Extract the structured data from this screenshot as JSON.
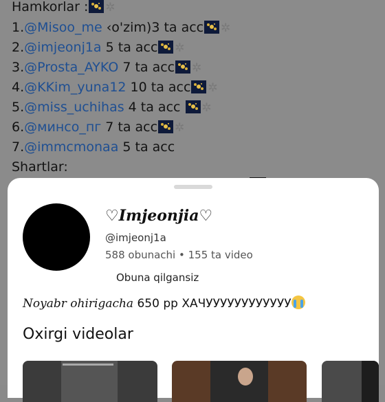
{
  "message": {
    "heading": "Hamkorlar :",
    "partners": [
      {
        "num": "1.",
        "handle": "@Misoo_me",
        "rest": " ‹o'zim)3 ta acc",
        "fireworks": true,
        "web": true
      },
      {
        "num": "2.",
        "handle": "@imjeonj1a",
        "rest": " 5 ta acc",
        "fireworks": true,
        "web": true
      },
      {
        "num": "3.",
        "handle": "@Prosta_AYKO",
        "rest": " 7 ta acc",
        "fireworks": true,
        "web": true
      },
      {
        "num": "4.",
        "handle": "@KKim_yuna12",
        "rest": " 10 ta acc",
        "fireworks": true,
        "web": true
      },
      {
        "num": "5.",
        "handle": "@miss_uchihas",
        "rest": " 4 ta acc ",
        "fireworks": true,
        "web": true
      },
      {
        "num": "6.",
        "handle": "@минсо_пг",
        "rest": " 7 ta acc",
        "fireworks": true,
        "web": true
      },
      {
        "num": "7.",
        "handle": "@immcmonaa",
        "rest": " 5 ta acc",
        "fireworks": false,
        "web": false
      }
    ],
    "conditions_label": "Shartlar:"
  },
  "profile": {
    "display_name": "♡𝑰𝒎𝒋𝒆𝒐𝒏𝒋𝒊𝒂♡",
    "username": "@imjeonj1a",
    "stats": "588 obunachi • 155 ta video",
    "subscribe_status": "Obuna qilgansiz",
    "bio_italic": "Noyabr ohirigacha",
    "bio_rest": " 650 pp ХАЧУУУУУУУУУУУУ",
    "bio_emoji": "crying-face-icon"
  },
  "recent_videos": {
    "title": "Oxirgi videolar"
  },
  "icons": {
    "fireworks": "fireworks-icon",
    "web": "spider-web-icon"
  }
}
